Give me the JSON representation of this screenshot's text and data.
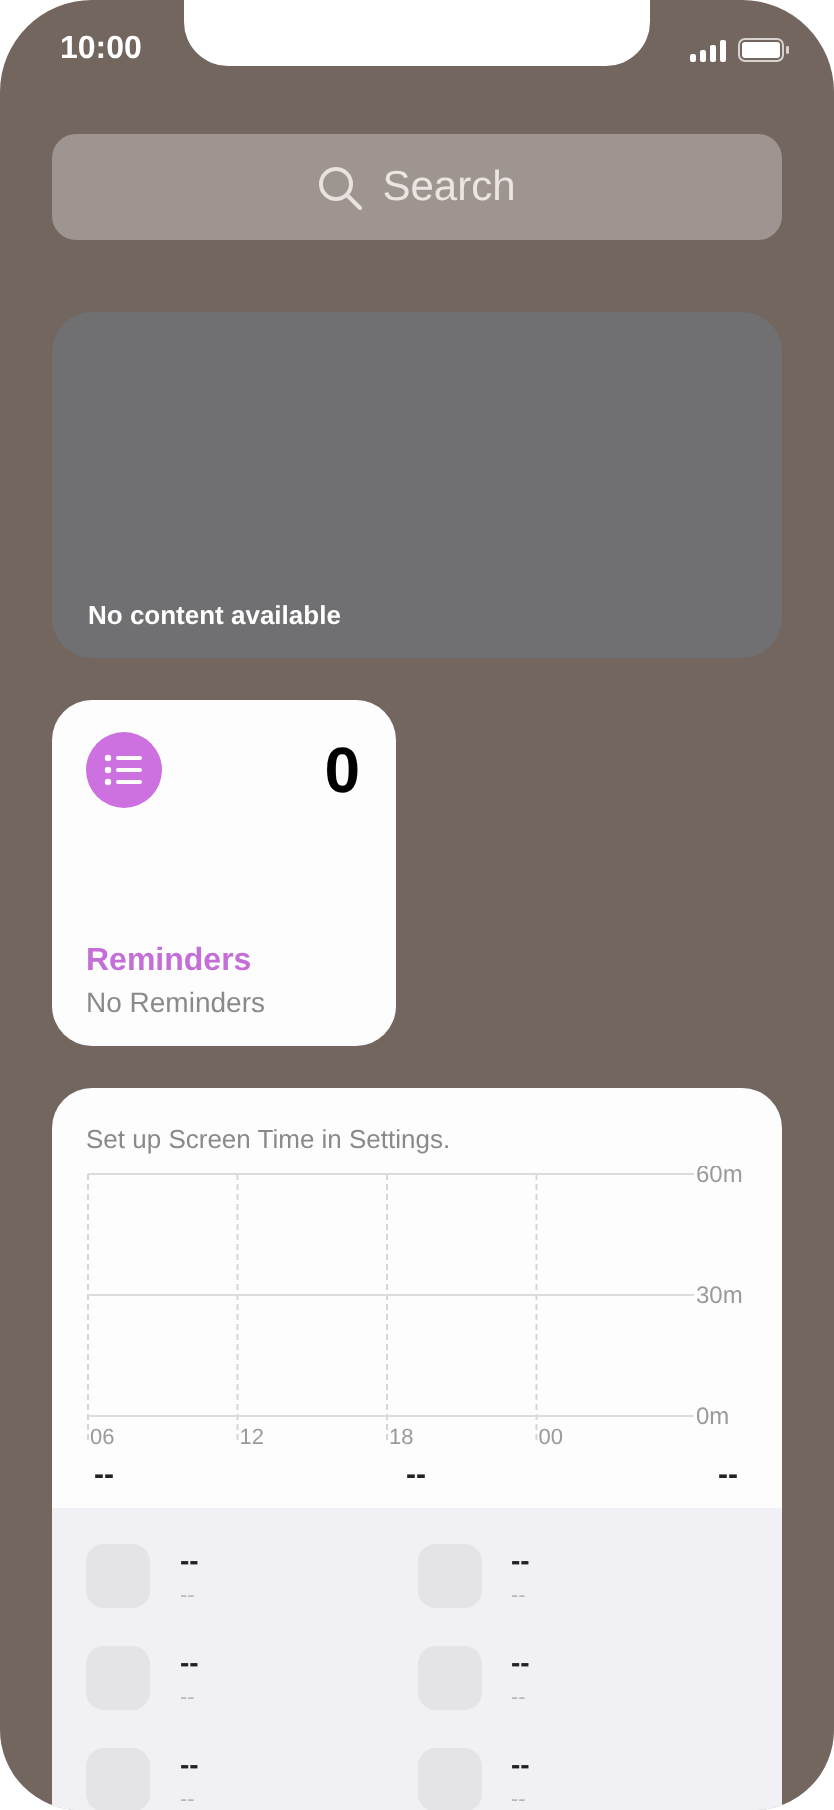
{
  "status_bar": {
    "time": "10:00"
  },
  "search": {
    "placeholder": "Search"
  },
  "empty_widget": {
    "message": "No content available"
  },
  "reminders_widget": {
    "count": "0",
    "title": "Reminders",
    "subtitle": "No Reminders"
  },
  "screen_time_widget": {
    "message": "Set up Screen Time in Settings.",
    "y_labels": [
      "60m",
      "30m",
      "0m"
    ],
    "x_labels": [
      "06",
      "12",
      "18",
      "00"
    ],
    "totals": [
      "--",
      "--",
      "--"
    ],
    "apps": [
      {
        "title": "--",
        "subtitle": "--"
      },
      {
        "title": "--",
        "subtitle": "--"
      },
      {
        "title": "--",
        "subtitle": "--"
      },
      {
        "title": "--",
        "subtitle": "--"
      },
      {
        "title": "--",
        "subtitle": "--"
      },
      {
        "title": "--",
        "subtitle": "--"
      }
    ]
  }
}
